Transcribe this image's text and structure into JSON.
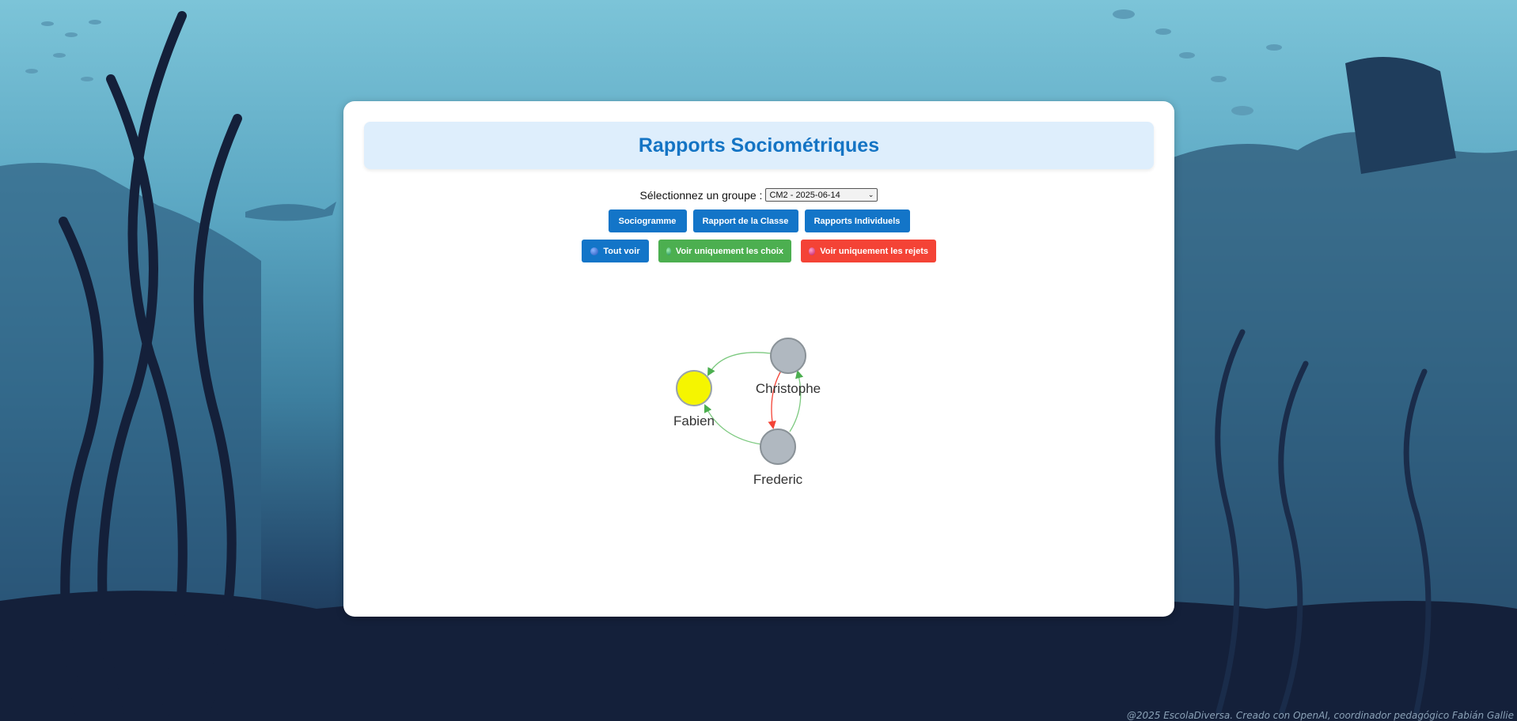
{
  "app": {
    "title": "Rapports Sociométriques"
  },
  "group_selector": {
    "label": "Sélectionnez un groupe :",
    "selected": "CM2 - 2025-06-14"
  },
  "nav_buttons": {
    "sociogram": "Sociogramme",
    "class_report": "Rapport de la Classe",
    "individual_reports": "Rapports Individuels"
  },
  "filter_buttons": {
    "all": "Tout voir",
    "choices_only": "Voir uniquement les choix",
    "rejections_only": "Voir uniquement les rejets"
  },
  "colors": {
    "primary": "#1375c8",
    "choices": "#4caf50",
    "rejections": "#f44336",
    "node_default": "#b0b8c0",
    "node_highlight": "#f5f500"
  },
  "sociogram": {
    "nodes": [
      {
        "id": "fabien",
        "label": "Fabien",
        "highlighted": true
      },
      {
        "id": "christophe",
        "label": "Christophe",
        "highlighted": false
      },
      {
        "id": "frederic",
        "label": "Frederic",
        "highlighted": false
      }
    ],
    "edges": [
      {
        "from": "Christophe",
        "to": "Fabien",
        "type": "choice"
      },
      {
        "from": "Frederic",
        "to": "Fabien",
        "type": "choice"
      },
      {
        "from": "Frederic",
        "to": "Christophe",
        "type": "choice"
      },
      {
        "from": "Christophe",
        "to": "Frederic",
        "type": "rejection"
      }
    ]
  },
  "footer": {
    "text": "@2025 EscolaDiversa. Creado con OpenAI, coordinador pedagógico Fabián Gallie"
  }
}
